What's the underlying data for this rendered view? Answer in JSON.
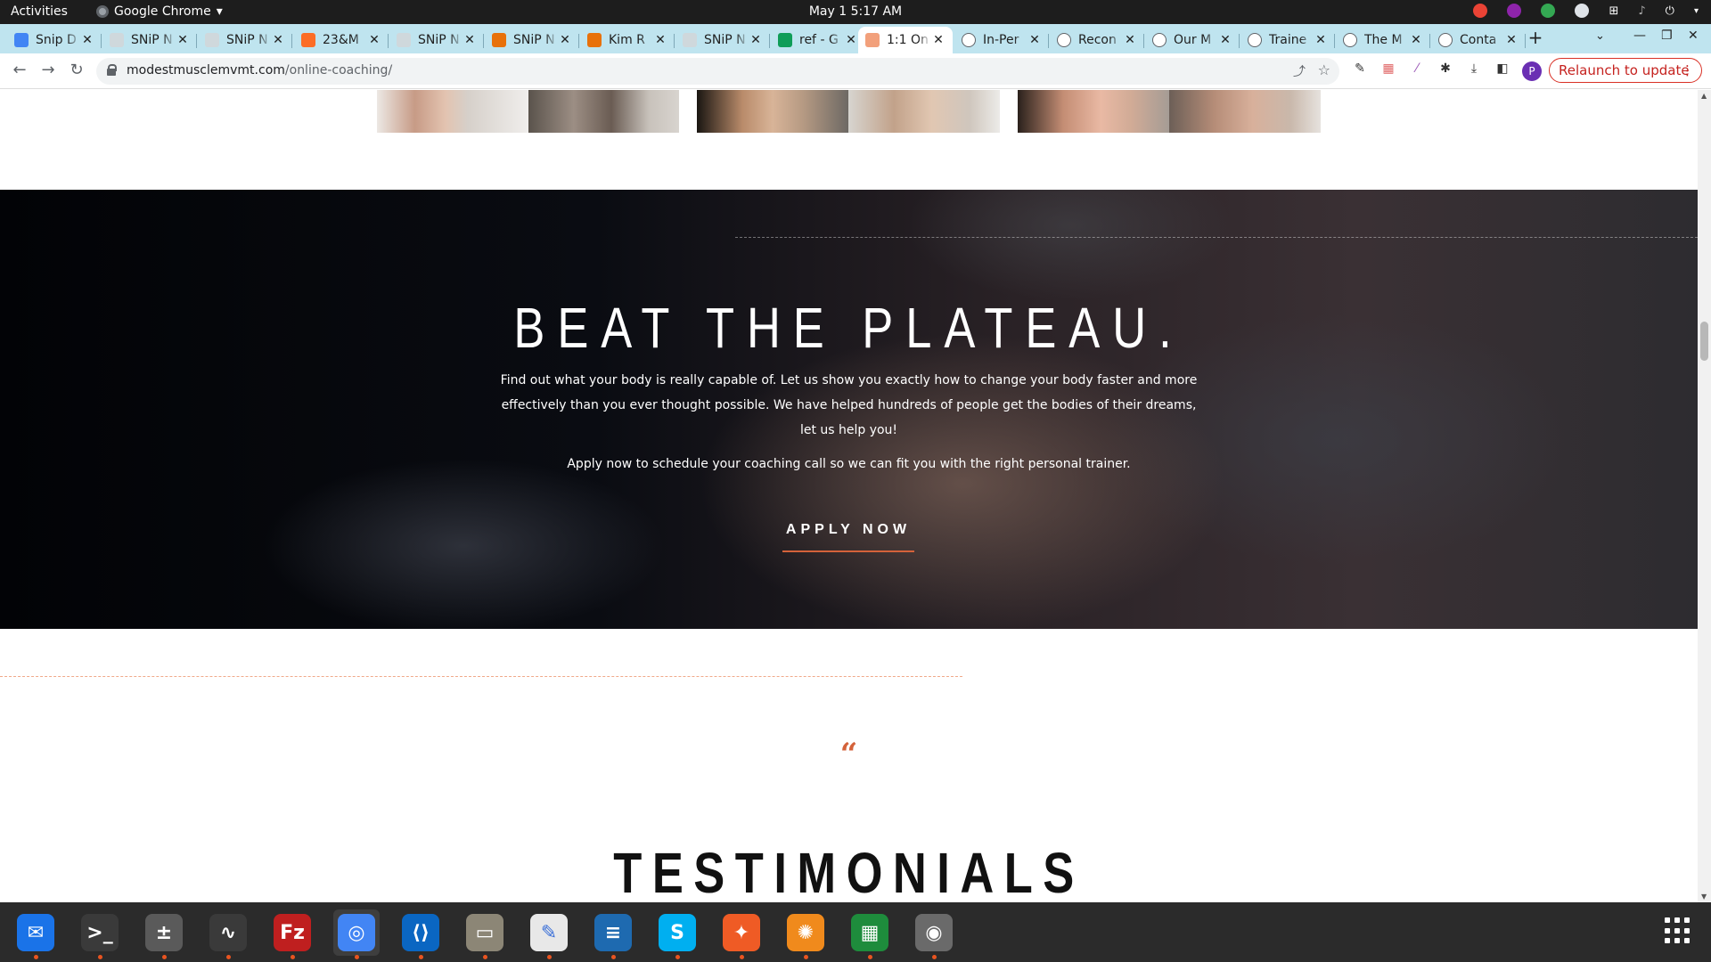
{
  "system_bar": {
    "activities": "Activities",
    "app_name": "Google Chrome",
    "app_menu_arrow": "▾",
    "clock": "May 1  5:17 AM"
  },
  "tabs": [
    {
      "title": "Snip D",
      "favicon": "docs-icon",
      "color": "#4285f4"
    },
    {
      "title": "SNiP N",
      "favicon": "snip-icon",
      "color": "#cfd8dc"
    },
    {
      "title": "SNiP N",
      "favicon": "snip-icon",
      "color": "#cfd8dc"
    },
    {
      "title": "23&M",
      "favicon": "gitlab-icon",
      "color": "#fc6d26"
    },
    {
      "title": "SNiP N",
      "favicon": "snip-icon",
      "color": "#cfd8dc"
    },
    {
      "title": "SNiP N",
      "favicon": "snip-icon",
      "color": "#e8710a"
    },
    {
      "title": "Kim R",
      "favicon": "snip-icon",
      "color": "#e8710a"
    },
    {
      "title": "SNiP N",
      "favicon": "snip-icon",
      "color": "#cfd8dc"
    },
    {
      "title": "ref - G",
      "favicon": "sheets-icon",
      "color": "#0f9d58"
    },
    {
      "title": "1:1 On",
      "favicon": "site-icon",
      "color": "#f2a07b"
    },
    {
      "title": "In-Per",
      "favicon": "globe-icon",
      "color": "#ffffff"
    },
    {
      "title": "Recon",
      "favicon": "globe-icon",
      "color": "#ffffff"
    },
    {
      "title": "Our M",
      "favicon": "globe-icon",
      "color": "#ffffff"
    },
    {
      "title": "Traine",
      "favicon": "globe-icon",
      "color": "#ffffff"
    },
    {
      "title": "The M",
      "favicon": "globe-icon",
      "color": "#ffffff"
    },
    {
      "title": "Conta",
      "favicon": "globe-icon",
      "color": "#ffffff"
    }
  ],
  "browser": {
    "url_host": "modestmusclemvmt.com",
    "url_path": "/online-coaching/",
    "relaunch_label": "Relaunch to update",
    "profile_initial": "P"
  },
  "hero": {
    "headline": "BEAT THE PLATEAU.",
    "paragraph1": "Find out what your body is really capable of. Let us show you exactly how to change your body faster and more effectively than you ever thought possible. We have helped hundreds of people get the bodies of their dreams, let us help you!",
    "paragraph2": "Apply now to schedule your coaching call so we can fit you with the right personal trainer.",
    "cta_label": "APPLY NOW"
  },
  "testimonials": {
    "quote_mark": "“",
    "heading": "TESTIMONIALS"
  },
  "colors": {
    "accent": "#d4623a",
    "tab_strip": "#bfe4ef",
    "relaunch_red": "#c5221f"
  },
  "dock": [
    {
      "name": "thunderbird",
      "color": "#1a73e8",
      "running": true
    },
    {
      "name": "terminal",
      "color": "#3a3a3a",
      "running": true
    },
    {
      "name": "calculator",
      "color": "#5a5a5a",
      "running": true
    },
    {
      "name": "system-monitor",
      "color": "#3a3a3a",
      "running": true
    },
    {
      "name": "filezilla",
      "color": "#bf1f1f",
      "running": true
    },
    {
      "name": "chrome",
      "color": "#4285f4",
      "running": true
    },
    {
      "name": "vscode",
      "color": "#0a66c2",
      "running": true
    },
    {
      "name": "files",
      "color": "#8c8676",
      "running": true
    },
    {
      "name": "text-editor",
      "color": "#e8e8e8",
      "running": true
    },
    {
      "name": "libreoffice-writer",
      "color": "#1e6ab0",
      "running": true
    },
    {
      "name": "skype",
      "color": "#00aff0",
      "running": true
    },
    {
      "name": "postman",
      "color": "#ef5b25",
      "running": true
    },
    {
      "name": "blaze",
      "color": "#f08a1c",
      "running": true
    },
    {
      "name": "libreoffice-calc",
      "color": "#1e8c3c",
      "running": true
    },
    {
      "name": "disk-utility",
      "color": "#6a6a6a",
      "running": true
    }
  ]
}
